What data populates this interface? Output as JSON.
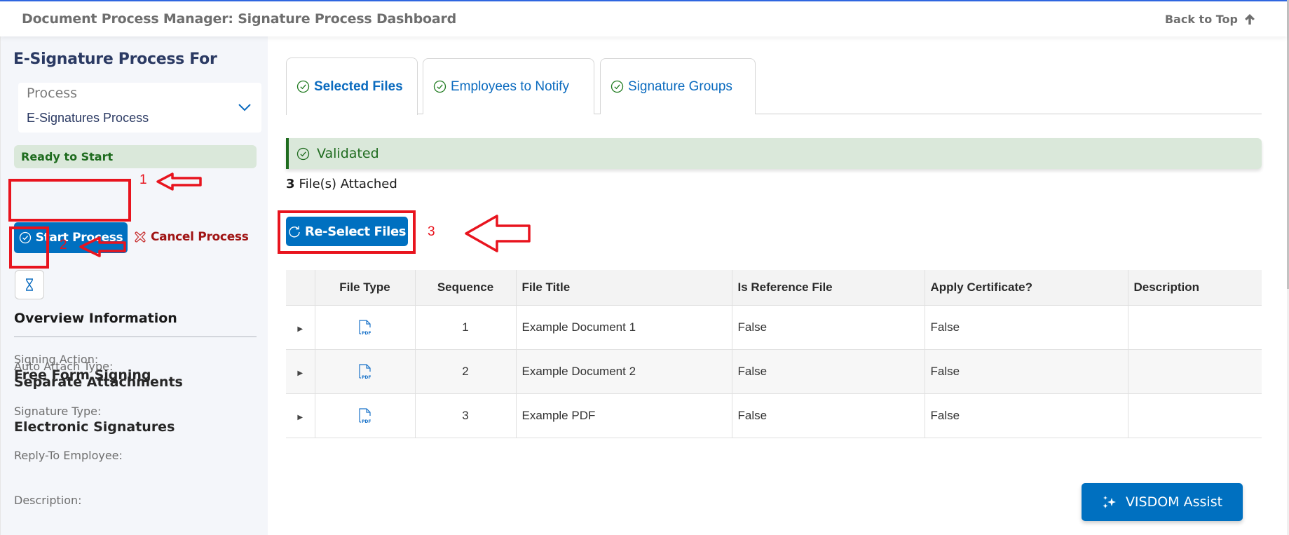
{
  "header": {
    "title": "Document Process Manager: Signature Process Dashboard",
    "back_to_top": "Back to Top"
  },
  "sidebar": {
    "title": "E-Signature Process For",
    "process_select": {
      "label": "Process",
      "value": "E-Signatures Process"
    },
    "status": "Ready to Start",
    "start_button": "Start Process",
    "cancel_button": "Cancel Process",
    "overview_title": "Overview Information",
    "overview": [
      {
        "label": "Signing Action:",
        "value": "Free Form Signing"
      },
      {
        "label": "Auto Attach Type:",
        "value": "Separate Attachments"
      },
      {
        "label": "Signature Type:",
        "value": "Electronic Signatures"
      },
      {
        "label": "Reply-To Employee:",
        "value": ""
      },
      {
        "label": "Description:",
        "value": ""
      }
    ]
  },
  "tabs": [
    {
      "label": "Selected Files",
      "active": true
    },
    {
      "label": "Employees to Notify",
      "active": false
    },
    {
      "label": "Signature Groups",
      "active": false
    }
  ],
  "main": {
    "validation_status": "Validated",
    "files_count": "3",
    "files_attached_label": "File(s) Attached",
    "reselect_button": "Re-Select Files"
  },
  "table": {
    "columns": [
      "",
      "File Type",
      "Sequence",
      "File Title",
      "Is Reference File",
      "Apply Certificate?",
      "Description"
    ],
    "rows": [
      {
        "file_type": "PDF",
        "sequence": "1",
        "title": "Example Document 1",
        "is_reference": "False",
        "apply_certificate": "False",
        "description": ""
      },
      {
        "file_type": "PDF",
        "sequence": "2",
        "title": "Example Document 2",
        "is_reference": "False",
        "apply_certificate": "False",
        "description": ""
      },
      {
        "file_type": "PDF",
        "sequence": "3",
        "title": "Example PDF",
        "is_reference": "False",
        "apply_certificate": "False",
        "description": ""
      }
    ]
  },
  "annotations": [
    {
      "number": "1",
      "target": "Start Process"
    },
    {
      "number": "2",
      "target": "hourglass button"
    },
    {
      "number": "3",
      "target": "Re-Select Files"
    }
  ],
  "assist_button": "VISDOM Assist",
  "colors": {
    "primary": "#0070c0",
    "success": "#1e6b1e",
    "success_bg": "#dae8da",
    "danger": "#a01414",
    "annotation": "#e8141e",
    "tab_text": "#0b6bbf"
  }
}
